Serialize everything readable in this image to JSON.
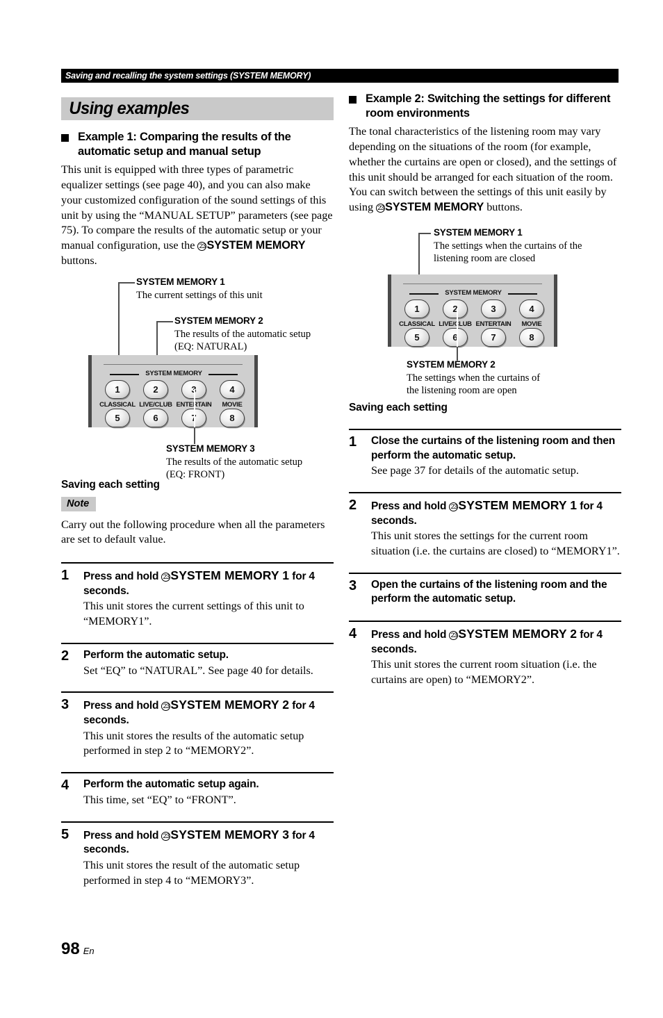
{
  "header": {
    "running_title": "Saving and recalling the system settings (SYSTEM MEMORY)"
  },
  "section": {
    "title": "Using examples"
  },
  "circled_number": "23",
  "left_column": {
    "heading": "Example 1: Comparing the results of the automatic setup and manual setup",
    "intro_part1": "This unit is equipped with three types of parametric equalizer settings (see page 40), and you can also make your customized configuration of the sound settings of this unit by using the “MANUAL SETUP” parameters (see page 75). To compare the results of the automatic setup or your manual configuration, use the ",
    "intro_bold": "SYSTEM MEMORY",
    "intro_part2": " buttons.",
    "figure": {
      "callout1_title": "SYSTEM MEMORY 1",
      "callout1_desc": "The current settings of this unit",
      "callout2_title": "SYSTEM MEMORY 2",
      "callout2_desc_line1": "The results of the automatic setup",
      "callout2_desc_line2": "(EQ: NATURAL)",
      "callout3_title": "SYSTEM MEMORY 3",
      "callout3_desc_line1": "The results of the automatic setup",
      "callout3_desc_line2": "(EQ: FRONT)",
      "panel_label": "SYSTEM MEMORY",
      "buttons_top": [
        "1",
        "2",
        "3",
        "4"
      ],
      "buttons_bottom": [
        "5",
        "6",
        "7",
        "8"
      ],
      "mode_labels": [
        "CLASSICAL",
        "LIVE/CLUB",
        "ENTERTAIN",
        "MOVIE"
      ]
    },
    "subhead": "Saving each setting",
    "note_tag": "Note",
    "note_text": "Carry out the following procedure when all the parameters are set to default value.",
    "steps": [
      {
        "num": "1",
        "title_pre": "Press and hold ",
        "title_strong": "SYSTEM MEMORY 1",
        "title_post": " for 4 seconds.",
        "desc": "This unit stores the current settings of this unit to “MEMORY1”."
      },
      {
        "num": "2",
        "title_pre": "Perform the automatic setup.",
        "title_strong": "",
        "title_post": "",
        "desc": "Set “EQ” to “NATURAL”. See page 40 for details."
      },
      {
        "num": "3",
        "title_pre": "Press and hold ",
        "title_strong": "SYSTEM MEMORY 2",
        "title_post": " for 4 seconds.",
        "desc": "This unit stores the results of the automatic setup performed in step 2 to “MEMORY2”."
      },
      {
        "num": "4",
        "title_pre": "Perform the automatic setup again.",
        "title_strong": "",
        "title_post": "",
        "desc": "This time, set “EQ” to “FRONT”."
      },
      {
        "num": "5",
        "title_pre": "Press and hold ",
        "title_strong": "SYSTEM MEMORY 3",
        "title_post": " for 4 seconds.",
        "desc": "This unit stores the result of the automatic setup performed in step 4 to “MEMORY3”."
      }
    ]
  },
  "right_column": {
    "heading": "Example 2: Switching the settings for different room environments",
    "intro_part1": "The tonal characteristics of the listening room may vary depending on the situations of the room (for example, whether the curtains are open or closed), and the settings of this unit should be arranged for each situation of the room. You can switch between the settings of this unit easily by using ",
    "intro_bold": "SYSTEM MEMORY",
    "intro_part2": " buttons.",
    "figure": {
      "callout1_title": "SYSTEM MEMORY 1",
      "callout1_desc_line1": "The settings when the curtains of the",
      "callout1_desc_line2": "listening room are closed",
      "callout2_title": "SYSTEM MEMORY 2",
      "callout2_desc_line1": "The settings when the curtains of",
      "callout2_desc_line2": "the listening room are open",
      "panel_label": "SYSTEM MEMORY",
      "buttons_top": [
        "1",
        "2",
        "3",
        "4"
      ],
      "buttons_bottom": [
        "5",
        "6",
        "7",
        "8"
      ],
      "mode_labels": [
        "CLASSICAL",
        "LIVE/CLUB",
        "ENTERTAIN",
        "MOVIE"
      ]
    },
    "subhead": "Saving each setting",
    "steps": [
      {
        "num": "1",
        "title_pre": "Close the curtains of the listening room and then perform the automatic setup.",
        "title_strong": "",
        "title_post": "",
        "desc": "See page 37 for details of the automatic setup."
      },
      {
        "num": "2",
        "title_pre": "Press and hold ",
        "title_strong": "SYSTEM MEMORY 1",
        "title_post": " for 4 seconds.",
        "desc": "This unit stores the settings for the current room situation (i.e. the curtains are closed) to “MEMORY1”."
      },
      {
        "num": "3",
        "title_pre": "Open the curtains of the listening room and the perform the automatic setup.",
        "title_strong": "",
        "title_post": "",
        "desc": ""
      },
      {
        "num": "4",
        "title_pre": "Press and hold ",
        "title_strong": "SYSTEM MEMORY 2",
        "title_post": " for 4 seconds.",
        "desc": "This unit stores the current room situation (i.e. the curtains are open) to “MEMORY2”."
      }
    ]
  },
  "footer": {
    "page_number": "98",
    "language": "En"
  },
  "colors": {
    "band": "#c9c9c9",
    "panel": "#cfcfcf",
    "panel_edge": "#4a4a4a",
    "header_bar": "#000000"
  }
}
